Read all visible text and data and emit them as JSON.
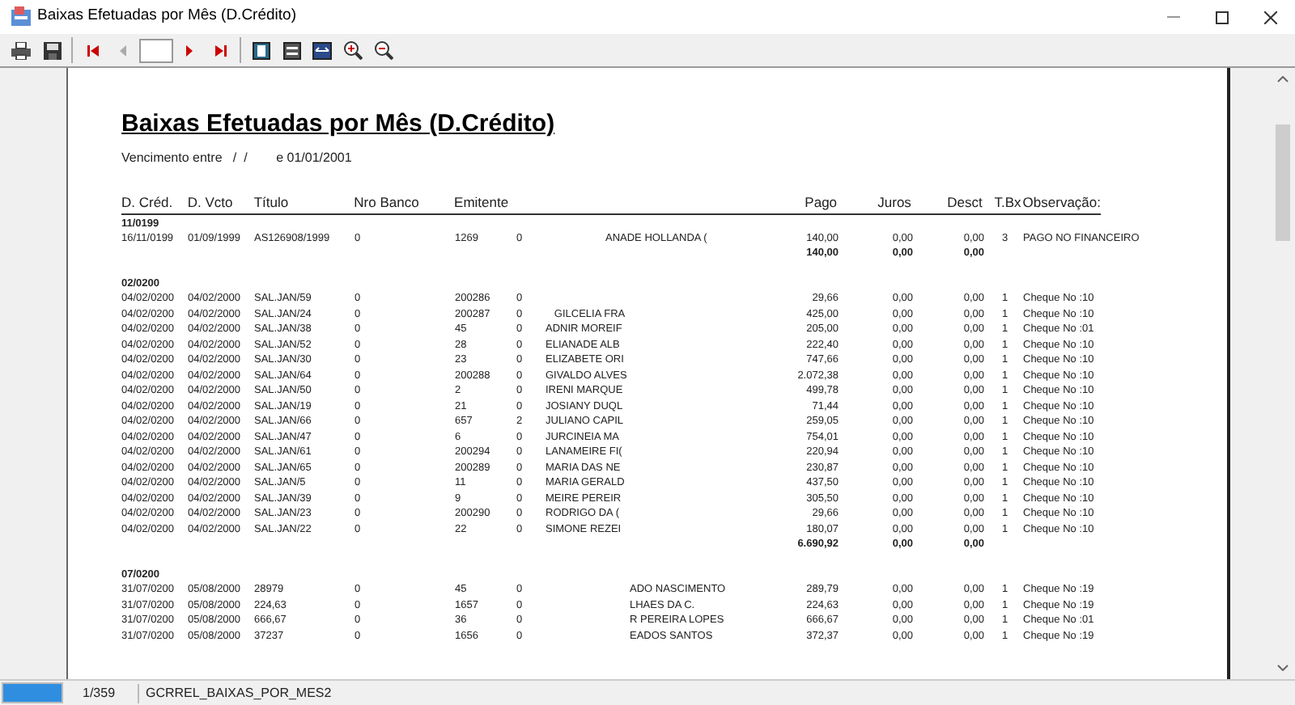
{
  "window": {
    "title": "Baixas Efetuadas por Mês (D.Crédito)"
  },
  "report": {
    "title": "Baixas Efetuadas por Mês (D.Crédito)",
    "subtitle": "Vencimento entre   /  /        e 01/01/2001",
    "columns": [
      "D. Créd.",
      "D. Vcto",
      "Título",
      "Nro Banco",
      "Emitente",
      "Pago",
      "Juros",
      "Desct",
      "T.Bx",
      "Observação:"
    ],
    "groups": [
      {
        "label": "11/0199",
        "rows": [
          {
            "d_cred": "16/11/0199",
            "d_vcto": "01/09/1999",
            "titulo": "AS126908/1999",
            "banco": "0",
            "emitente": "1269",
            "col_6": "0",
            "nome": "ANADE HOLLANDA (",
            "pago": "140,00",
            "juros": "0,00",
            "desct": "0,00",
            "tbx": "3",
            "obs": "PAGO NO FINANCEIRO"
          }
        ],
        "total": {
          "pago": "140,00",
          "juros": "0,00",
          "desct": "0,00"
        }
      },
      {
        "label": "02/0200",
        "rows": [
          {
            "d_cred": "04/02/0200",
            "d_vcto": "04/02/2000",
            "titulo": "SAL.JAN/59",
            "banco": "0",
            "emitente": "200286",
            "col_6": "0",
            "pago": "29,66",
            "juros": "0,00",
            "desct": "0,00",
            "tbx": "1",
            "obs": "Cheque No :10"
          },
          {
            "d_cred": "04/02/0200",
            "d_vcto": "04/02/2000",
            "titulo": "SAL.JAN/24",
            "banco": "0",
            "emitente": "200287",
            "col_6": "0",
            "nome": "   GILCELIA FRA",
            "pago": "425,00",
            "juros": "0,00",
            "desct": "0,00",
            "tbx": "1",
            "obs": "Cheque No :10"
          },
          {
            "d_cred": "04/02/0200",
            "d_vcto": "04/02/2000",
            "titulo": "SAL.JAN/38",
            "banco": "0",
            "emitente": "45",
            "col_6": "0",
            "nome": "ADNIR MOREIF",
            "pago": "205,00",
            "juros": "0,00",
            "desct": "0,00",
            "tbx": "1",
            "obs": "Cheque No :01"
          },
          {
            "d_cred": "04/02/0200",
            "d_vcto": "04/02/2000",
            "titulo": "SAL.JAN/52",
            "banco": "0",
            "emitente": "28",
            "col_6": "0",
            "nome": "ELIANADE ALB",
            "pago": "222,40",
            "juros": "0,00",
            "desct": "0,00",
            "tbx": "1",
            "obs": "Cheque No :10"
          },
          {
            "d_cred": "04/02/0200",
            "d_vcto": "04/02/2000",
            "titulo": "SAL.JAN/30",
            "banco": "0",
            "emitente": "23",
            "col_6": "0",
            "nome": "ELIZABETE ORI",
            "pago": "747,66",
            "juros": "0,00",
            "desct": "0,00",
            "tbx": "1",
            "obs": "Cheque No :10"
          },
          {
            "d_cred": "04/02/0200",
            "d_vcto": "04/02/2000",
            "titulo": "SAL.JAN/64",
            "banco": "0",
            "emitente": "200288",
            "col_6": "0",
            "nome": "GIVALDO ALVES",
            "pago": "2.072,38",
            "juros": "0,00",
            "desct": "0,00",
            "tbx": "1",
            "obs": "Cheque No :10"
          },
          {
            "d_cred": "04/02/0200",
            "d_vcto": "04/02/2000",
            "titulo": "SAL.JAN/50",
            "banco": "0",
            "emitente": "2",
            "col_6": "0",
            "nome": "IRENI MARQUE",
            "pago": "499,78",
            "juros": "0,00",
            "desct": "0,00",
            "tbx": "1",
            "obs": "Cheque No :10"
          },
          {
            "d_cred": "04/02/0200",
            "d_vcto": "04/02/2000",
            "titulo": "SAL.JAN/19",
            "banco": "0",
            "emitente": "21",
            "col_6": "0",
            "nome": "JOSIANY DUQL",
            "pago": "71,44",
            "juros": "0,00",
            "desct": "0,00",
            "tbx": "1",
            "obs": "Cheque No :10"
          },
          {
            "d_cred": "04/02/0200",
            "d_vcto": "04/02/2000",
            "titulo": "SAL.JAN/66",
            "banco": "0",
            "emitente": "657",
            "col_6": "2",
            "nome": "JULIANO CAPIL",
            "pago": "259,05",
            "juros": "0,00",
            "desct": "0,00",
            "tbx": "1",
            "obs": "Cheque No :10"
          },
          {
            "d_cred": "04/02/0200",
            "d_vcto": "04/02/2000",
            "titulo": "SAL.JAN/47",
            "banco": "0",
            "emitente": "6",
            "col_6": "0",
            "nome": "JURCINEIA MA",
            "pago": "754,01",
            "juros": "0,00",
            "desct": "0,00",
            "tbx": "1",
            "obs": "Cheque No :10"
          },
          {
            "d_cred": "04/02/0200",
            "d_vcto": "04/02/2000",
            "titulo": "SAL.JAN/61",
            "banco": "0",
            "emitente": "200294",
            "col_6": "0",
            "nome": "LANAMEIRE FI(",
            "pago": "220,94",
            "juros": "0,00",
            "desct": "0,00",
            "tbx": "1",
            "obs": "Cheque No :10"
          },
          {
            "d_cred": "04/02/0200",
            "d_vcto": "04/02/2000",
            "titulo": "SAL.JAN/65",
            "banco": "0",
            "emitente": "200289",
            "col_6": "0",
            "nome": "MARIA DAS NE",
            "pago": "230,87",
            "juros": "0,00",
            "desct": "0,00",
            "tbx": "1",
            "obs": "Cheque No :10"
          },
          {
            "d_cred": "04/02/0200",
            "d_vcto": "04/02/2000",
            "titulo": "SAL.JAN/5",
            "banco": "0",
            "emitente": "11",
            "col_6": "0",
            "nome": "MARIA GERALD",
            "pago": "437,50",
            "juros": "0,00",
            "desct": "0,00",
            "tbx": "1",
            "obs": "Cheque No :10"
          },
          {
            "d_cred": "04/02/0200",
            "d_vcto": "04/02/2000",
            "titulo": "SAL.JAN/39",
            "banco": "0",
            "emitente": "9",
            "col_6": "0",
            "nome": "MEIRE PEREIR",
            "pago": "305,50",
            "juros": "0,00",
            "desct": "0,00",
            "tbx": "1",
            "obs": "Cheque No :10"
          },
          {
            "d_cred": "04/02/0200",
            "d_vcto": "04/02/2000",
            "titulo": "SAL.JAN/23",
            "banco": "0",
            "emitente": "200290",
            "col_6": "0",
            "nome": "RODRIGO DA (",
            "pago": "29,66",
            "juros": "0,00",
            "desct": "0,00",
            "tbx": "1",
            "obs": "Cheque No :10"
          },
          {
            "d_cred": "04/02/0200",
            "d_vcto": "04/02/2000",
            "titulo": "SAL.JAN/22",
            "banco": "0",
            "emitente": "22",
            "col_6": "0",
            "nome": "SIMONE REZEI",
            "pago": "180,07",
            "juros": "0,00",
            "desct": "0,00",
            "tbx": "1",
            "obs": "Cheque No :10"
          }
        ],
        "total": {
          "pago": "6.690,92",
          "juros": "0,00",
          "desct": "0,00"
        }
      },
      {
        "label": "07/0200",
        "rows": [
          {
            "d_cred": "31/07/0200",
            "d_vcto": "05/08/2000",
            "titulo": "28979",
            "banco": "0",
            "emitente": "45",
            "col_6": "0",
            "nome": "ADO NASCIMENTO",
            "pago": "289,79",
            "juros": "0,00",
            "desct": "0,00",
            "tbx": "1",
            "obs": "Cheque No :19"
          },
          {
            "d_cred": "31/07/0200",
            "d_vcto": "05/08/2000",
            "titulo": "224,63",
            "banco": "0",
            "emitente": "1657",
            "col_6": "0",
            "nome": "LHAES DA C.",
            "pago": "224,63",
            "juros": "0,00",
            "desct": "0,00",
            "tbx": "1",
            "obs": "Cheque No :19"
          },
          {
            "d_cred": "31/07/0200",
            "d_vcto": "05/08/2000",
            "titulo": "666,67",
            "banco": "0",
            "emitente": "36",
            "col_6": "0",
            "nome": "R PEREIRA LOPES",
            "pago": "666,67",
            "juros": "0,00",
            "desct": "0,00",
            "tbx": "1",
            "obs": "Cheque No :01"
          },
          {
            "d_cred": "31/07/0200",
            "d_vcto": "05/08/2000",
            "titulo": "37237",
            "banco": "0",
            "emitente": "1656",
            "col_6": "0",
            "nome": "EADOS SANTOS",
            "pago": "372,37",
            "juros": "0,00",
            "desct": "0,00",
            "tbx": "1",
            "obs": "Cheque No :19"
          }
        ]
      }
    ]
  },
  "status_bar": {
    "progress": {
      "level": 1
    },
    "page": "1/359",
    "report_name": "GCRREL_BAIXAS_POR_MES2"
  }
}
